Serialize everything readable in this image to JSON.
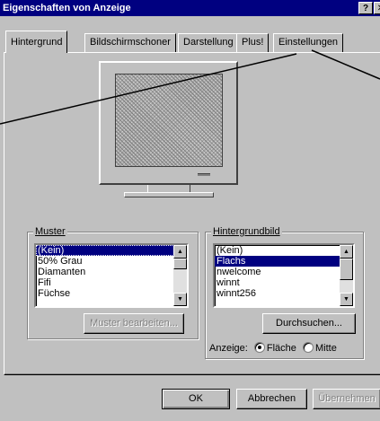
{
  "window": {
    "title": "Eigenschaften von Anzeige",
    "help_button": "?",
    "close_button": "✕"
  },
  "tabs": [
    {
      "label": "Hintergrund",
      "active": true
    },
    {
      "label": "Bildschirmschoner",
      "active": false
    },
    {
      "label": "Darstellung",
      "active": false
    },
    {
      "label": "Plus!",
      "active": false
    },
    {
      "label": "Einstellungen",
      "active": false
    }
  ],
  "muster": {
    "group_label": "Muster",
    "items": [
      "(Kein)",
      "50% Grau",
      "Diamanten",
      "Fifi",
      "Füchse"
    ],
    "selected": "(Kein)",
    "edit_button": "Muster bearbeiten..."
  },
  "hintergrundbild": {
    "group_label": "Hintergrundbild",
    "items": [
      "(Kein)",
      "Flachs",
      "nwelcome",
      "winnt",
      "winnt256"
    ],
    "selected": "Flachs",
    "browse_button": "Durchsuchen...",
    "display_label": "Anzeige:",
    "option_flaeche": "Fläche",
    "option_mitte": "Mitte",
    "display_selected": "Fläche"
  },
  "footer": {
    "ok_label": "OK",
    "cancel_label": "Abbrechen",
    "apply_label": "Übernehmen"
  },
  "colors": {
    "titlebar": "#000080",
    "face": "#c0c0c0",
    "selection": "#000080"
  }
}
